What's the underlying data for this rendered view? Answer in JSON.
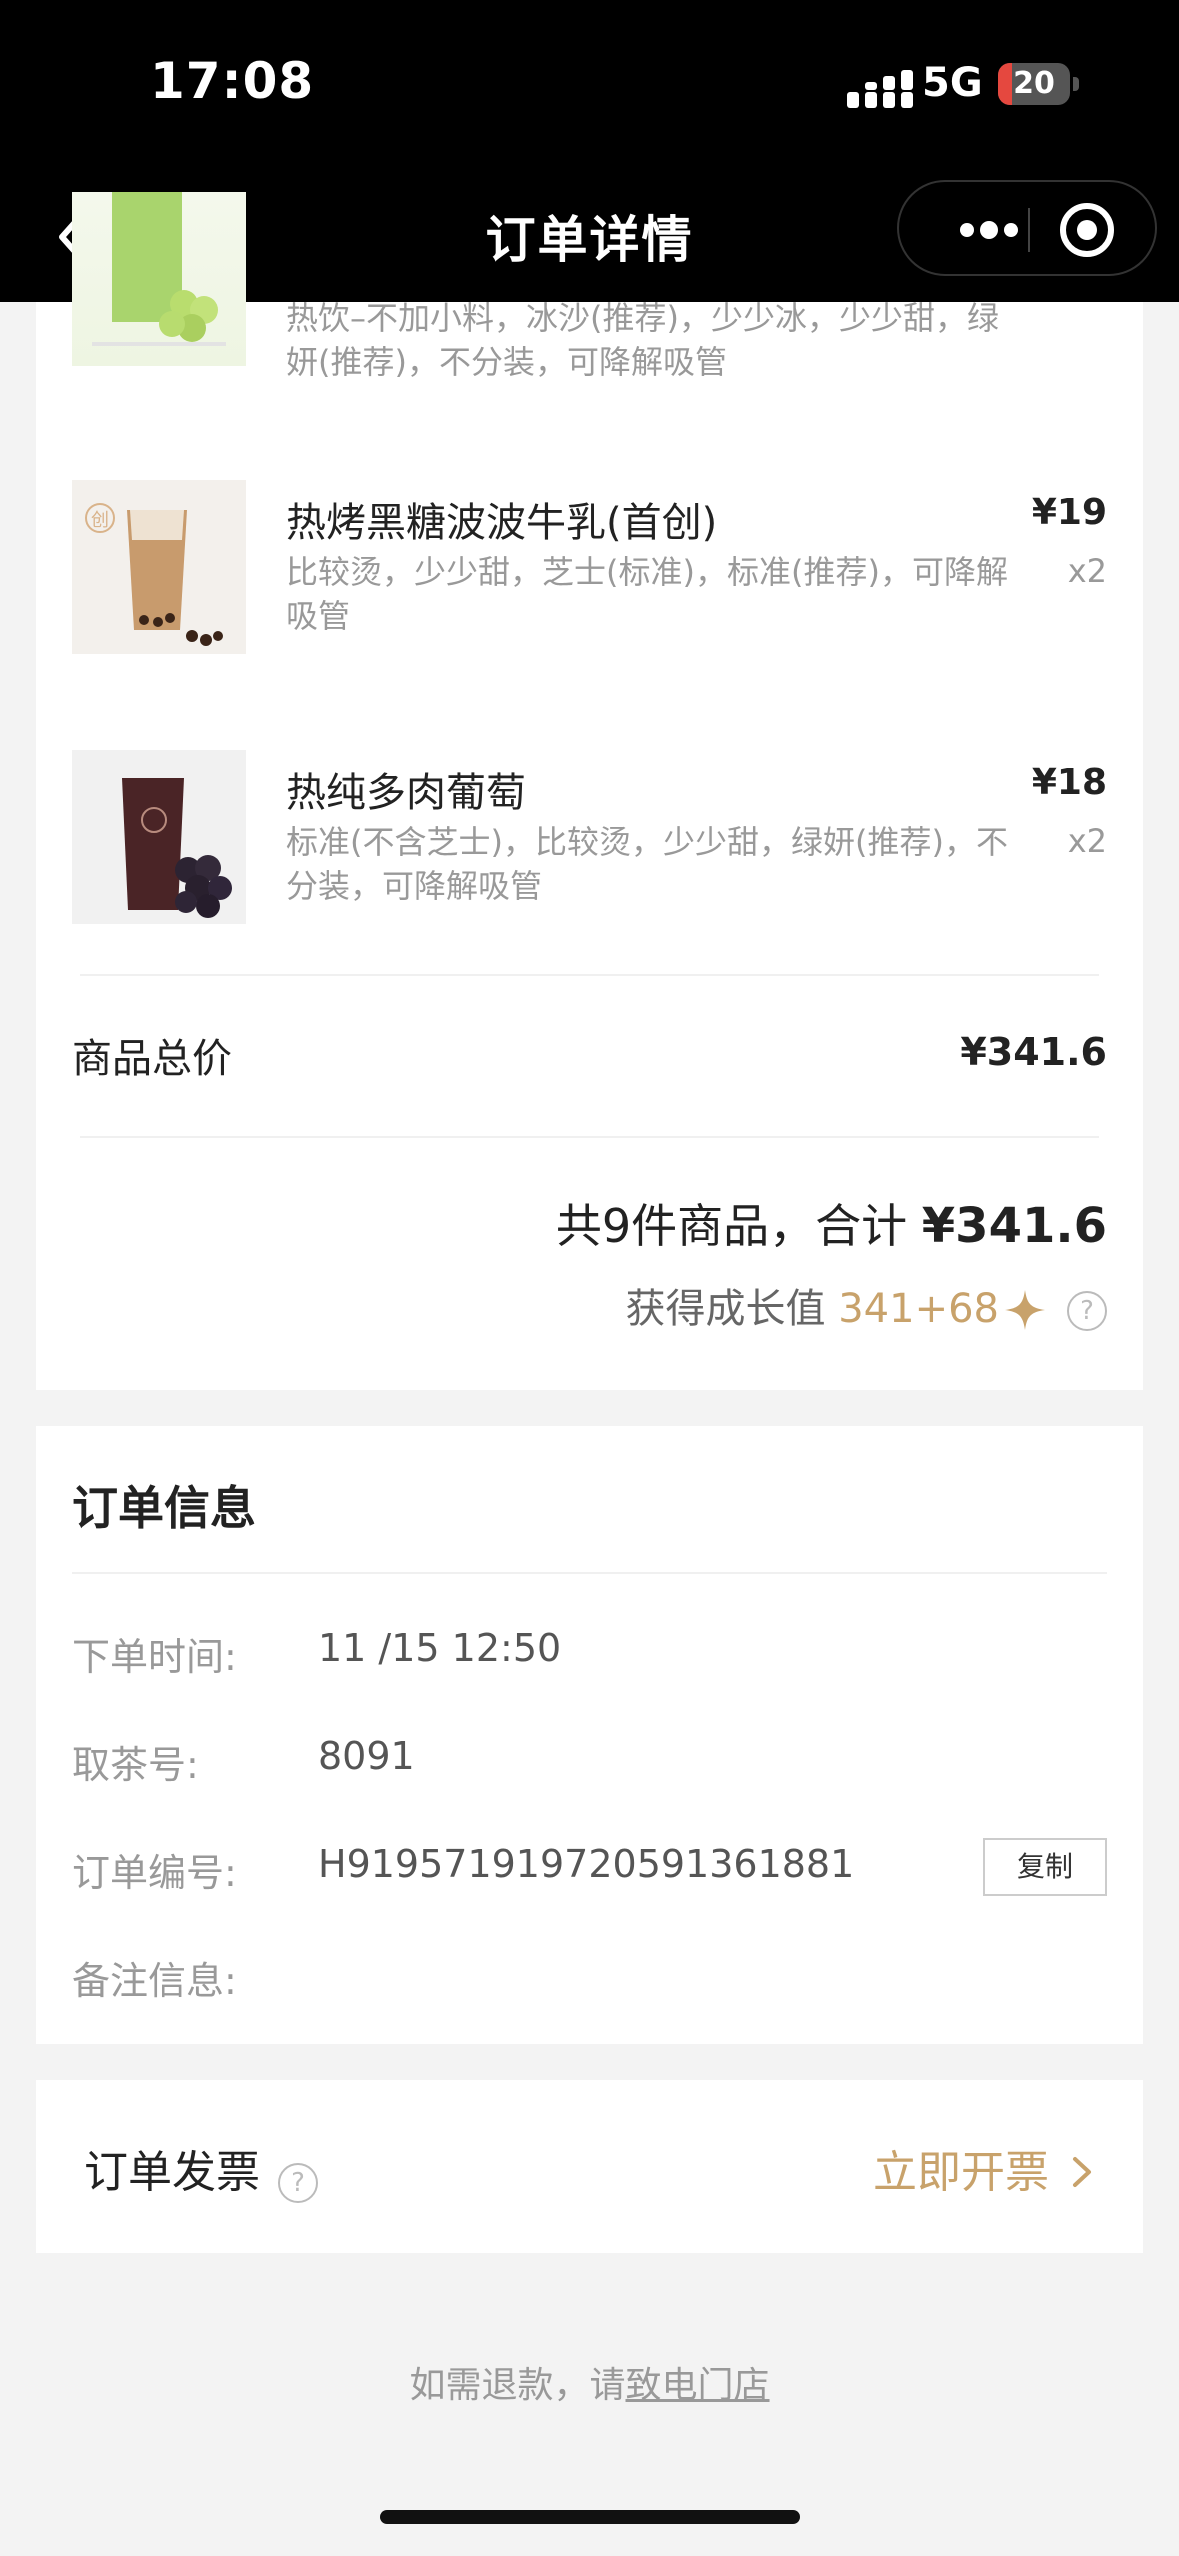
{
  "status_bar": {
    "time": "17:08",
    "network": "5G",
    "battery": "20",
    "icons": [
      "signal-icon",
      "battery-icon"
    ]
  },
  "nav": {
    "title": "订单详情",
    "icons": [
      "back-arrow-icon",
      "more-dots-icon",
      "close-target-icon"
    ]
  },
  "items": [
    {
      "name": "",
      "spec": "热饮–不加小料，冰沙(推荐)，少少冰，少少甜，绿妍(推荐)，不分装，可降解吸管",
      "image": "green-grape-drink"
    },
    {
      "name": "热烤黑糖波波牛乳(首创)",
      "spec": "比较烫，少少甜，芝士(标准)，标准(推荐)，可降解吸管",
      "price": "¥19",
      "qty": "x2",
      "badge": "创",
      "image": "brown-sugar-boba-milk"
    },
    {
      "name": "热纯多肉葡萄",
      "spec": "标准(不含芝士)，比较烫，少少甜，绿妍(推荐)，不分装，可降解吸管",
      "price": "¥18",
      "qty": "x2",
      "image": "grape-tea"
    }
  ],
  "summary": {
    "subtotal_label": "商品总价",
    "subtotal_value": "¥341.6",
    "total_prefix": "共9件商品，合计 ",
    "total_value": "¥341.6",
    "growth_label": "获得成长值 ",
    "growth_value": "341+68",
    "help": "?"
  },
  "order_info": {
    "title": "订单信息",
    "rows": [
      {
        "label": "下单时间:",
        "value": "11 /15 12:50"
      },
      {
        "label": "取茶号:",
        "value": "8091"
      },
      {
        "label": "订单编号:",
        "value": "H919571919720591361881"
      },
      {
        "label": "备注信息:",
        "value": ""
      }
    ],
    "copy_label": "复制"
  },
  "invoice": {
    "label": "订单发票",
    "help": "?",
    "action": "立即开票"
  },
  "refund": {
    "text": "如需退款，请",
    "link": "致电门店"
  },
  "colors": {
    "accent_gold": "#c8a26b",
    "bar_black": "#000000",
    "page_bg": "#f3f3f3",
    "battery_red": "#e5483f"
  }
}
